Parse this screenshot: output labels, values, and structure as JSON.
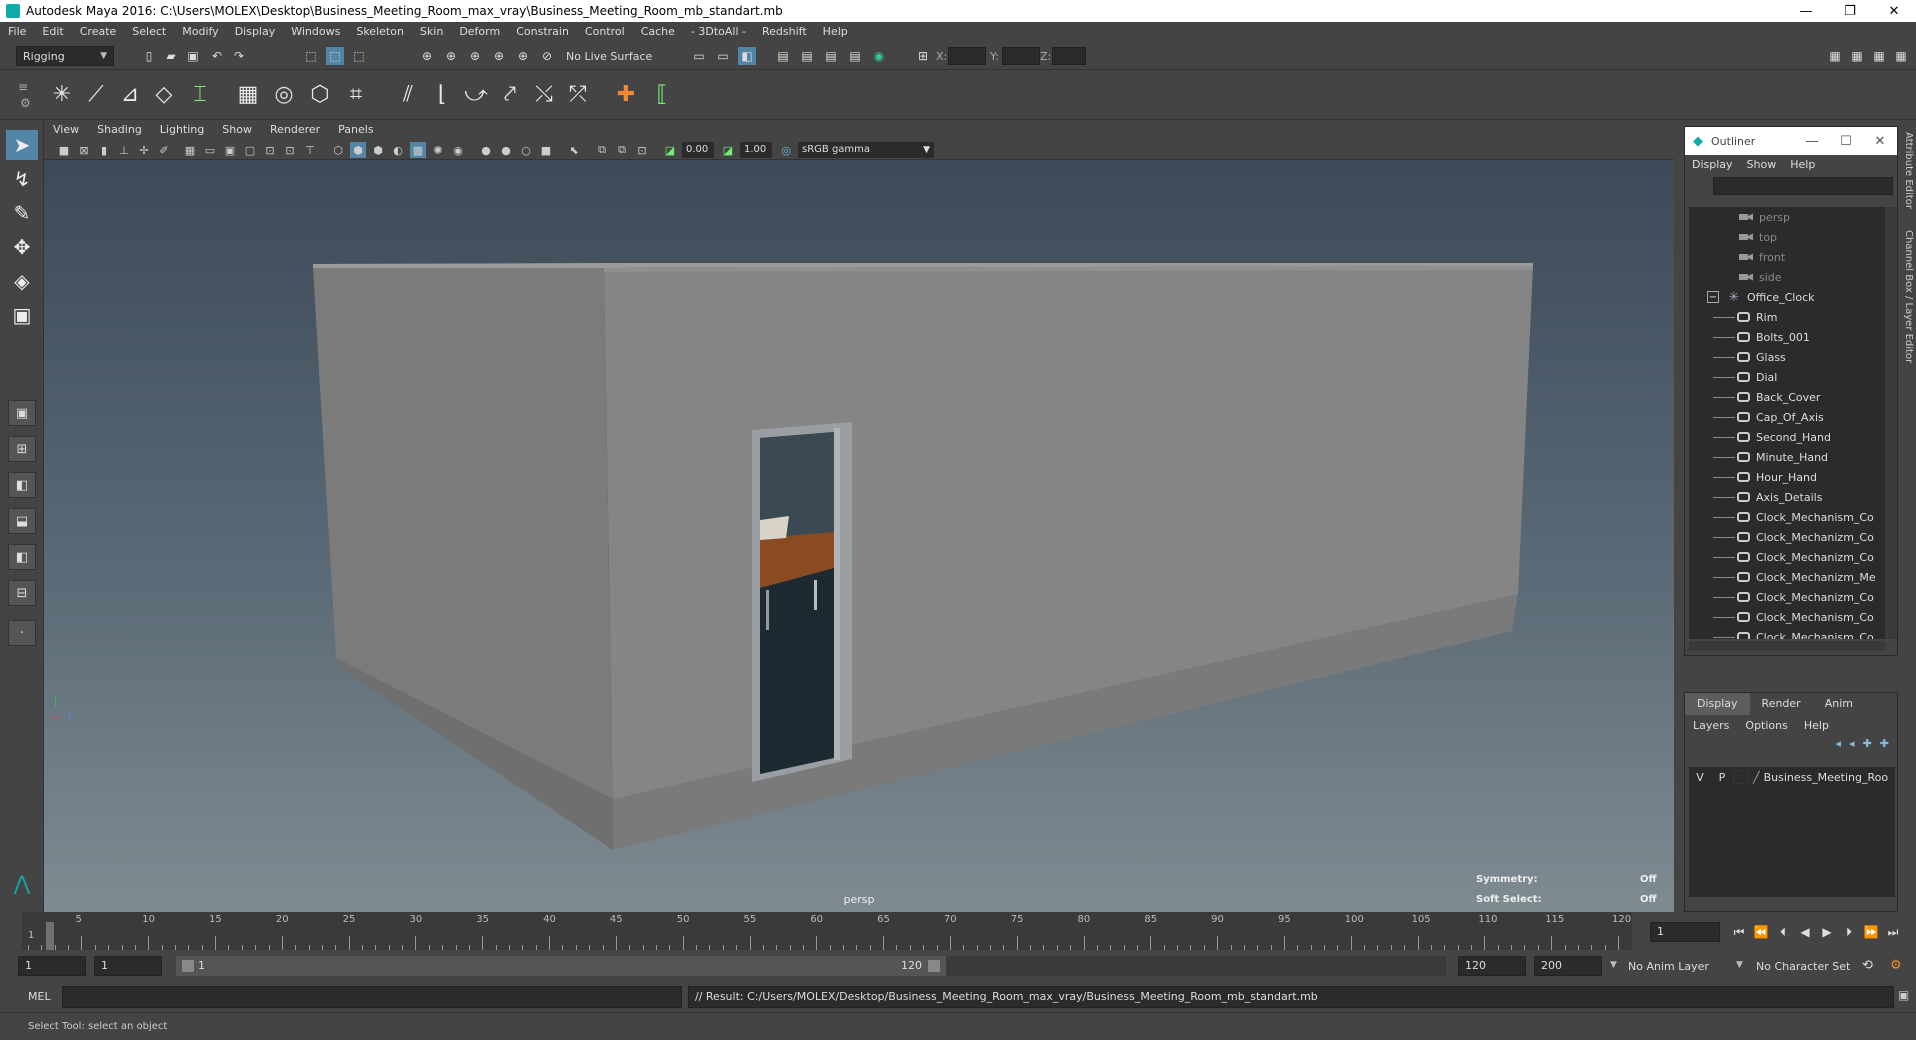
{
  "window": {
    "title": "Autodesk Maya 2016: C:\\Users\\MOLEX\\Desktop\\Business_Meeting_Room_max_vray\\Business_Meeting_Room_mb_standart.mb",
    "minimize": "—",
    "restore": "❐",
    "close": "✕"
  },
  "menubar": [
    "File",
    "Edit",
    "Create",
    "Select",
    "Modify",
    "Display",
    "Windows",
    "Skeleton",
    "Skin",
    "Deform",
    "Constrain",
    "Control",
    "Cache",
    "- 3DtoAll -",
    "Redshift",
    "Help"
  ],
  "statusline": {
    "menuset": "Rigging",
    "live_surface": "No Live Surface",
    "x_label": "X:",
    "y_label": "Y:",
    "z_label": "Z:"
  },
  "viewport": {
    "menu": [
      "View",
      "Shading",
      "Lighting",
      "Show",
      "Renderer",
      "Panels"
    ],
    "exposure": "0.00",
    "gamma": "1.00",
    "color_space": "sRGB gamma",
    "camera_label": "persp",
    "hud": {
      "symmetry_label": "Symmetry:",
      "symmetry_value": "Off",
      "soft_select_label": "Soft Select:",
      "soft_select_value": "Off"
    }
  },
  "outliner": {
    "title": "Outliner",
    "menu": [
      "Display",
      "Show",
      "Help"
    ],
    "cameras": [
      "persp",
      "top",
      "front",
      "side"
    ],
    "group": "Office_Clock",
    "children": [
      "Rim",
      "Bolts_001",
      "Glass",
      "Dial",
      "Back_Cover",
      "Cap_Of_Axis",
      "Second_Hand",
      "Minute_Hand",
      "Hour_Hand",
      "Axis_Details",
      "Clock_Mechanism_Co",
      "Clock_Mechanizm_Co",
      "Clock_Mechanizm_Co",
      "Clock_Mechanizm_Me",
      "Clock_Mechanizm_Co",
      "Clock_Mechanism_Co",
      "Clock_Mechanism_Co"
    ]
  },
  "layers": {
    "tabs": [
      "Display",
      "Render",
      "Anim"
    ],
    "menu": [
      "Layers",
      "Options",
      "Help"
    ],
    "row": {
      "v": "V",
      "p": "P",
      "name": "Business_Meeting_Roo"
    }
  },
  "side_tabs": {
    "attribute_editor": "Attribute Editor",
    "channel_box": "Channel Box / Layer Editor"
  },
  "timeline": {
    "ticks": [
      "5",
      "10",
      "15",
      "20",
      "25",
      "30",
      "35",
      "40",
      "45",
      "50",
      "55",
      "60",
      "65",
      "70",
      "75",
      "80",
      "85",
      "90",
      "95",
      "100",
      "105",
      "110",
      "115",
      "120"
    ],
    "start_label": "1",
    "current_frame": "1"
  },
  "range": {
    "start": "1",
    "playback_start": "1",
    "range_start_label": "1",
    "range_end_label": "120",
    "playback_end": "120",
    "end": "200",
    "anim_layer": "No Anim Layer",
    "character_set": "No Character Set"
  },
  "cmdline": {
    "mode": "MEL",
    "result": "// Result: C:/Users/MOLEX/Desktop/Business_Meeting_Room_max_vray/Business_Meeting_Room_mb_standart.mb"
  },
  "status": {
    "help_line": "Select Tool: select an object"
  }
}
